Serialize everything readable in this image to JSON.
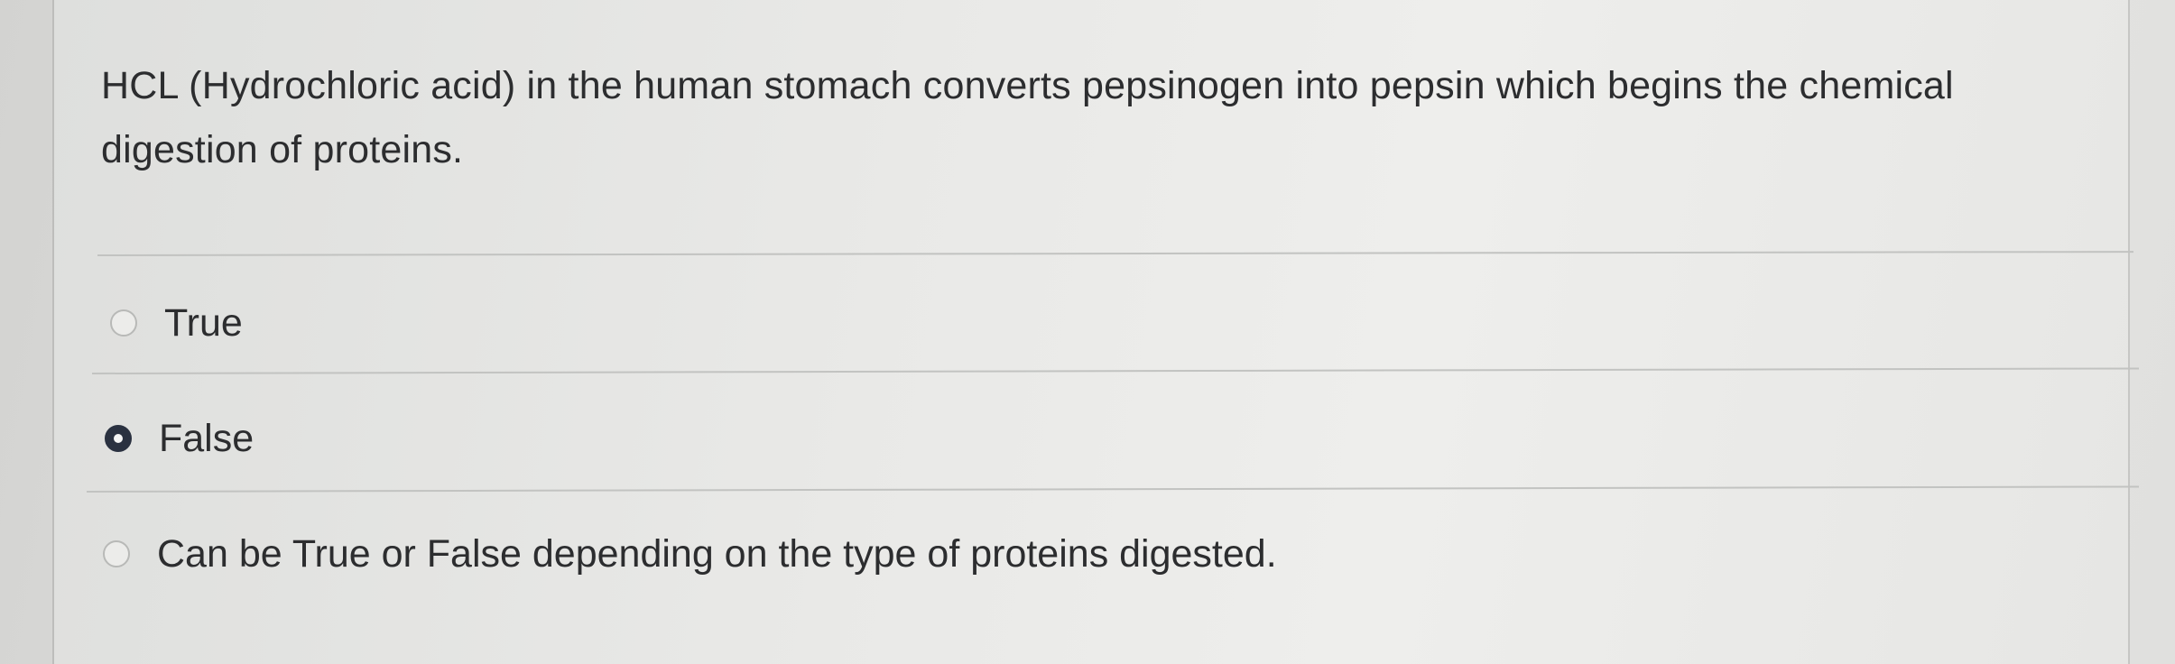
{
  "question": {
    "text": "HCL (Hydrochloric acid) in the human stomach  converts pepsinogen into pepsin which begins the chemical digestion of proteins."
  },
  "answers": [
    {
      "label": "True",
      "selected": false
    },
    {
      "label": "False",
      "selected": true
    },
    {
      "label": "Can be True or False depending on the type of proteins digested.",
      "selected": false
    }
  ],
  "colors": {
    "selected_radio": "#2a3140",
    "text": "#2c2d2f"
  }
}
